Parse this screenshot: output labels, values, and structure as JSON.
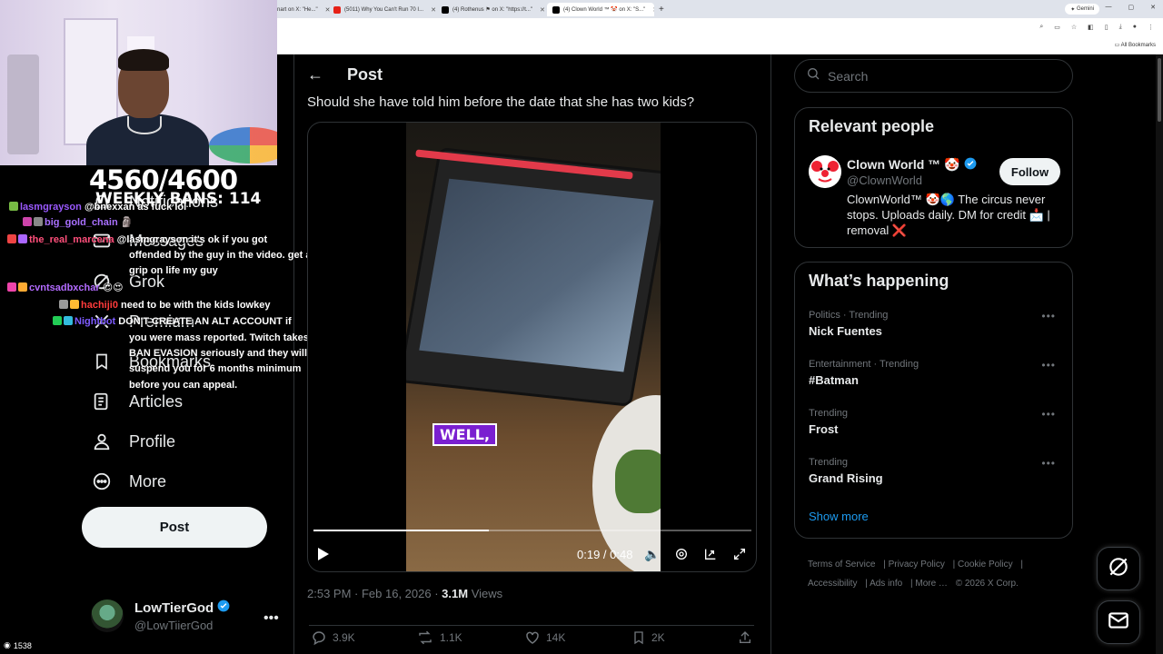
{
  "browser": {
    "tabs": [
      {
        "label": "nart on X: \"He...\"",
        "favicon": "x-icon"
      },
      {
        "label": "(5011) Why You Can't Run 70 I...",
        "favicon": "youtube-icon"
      },
      {
        "label": "(4) Rothenus ⚑ on X: \"https://t...\"",
        "favicon": "x-icon"
      },
      {
        "label": "(4) Clown World ™ 🤡 on X: \"S...\"",
        "favicon": "x-icon"
      }
    ],
    "gemini_label": "Gemini",
    "bookmarks_label": "All Bookmarks"
  },
  "stream": {
    "counter": "4560/4600",
    "weekly_bans": "WEEKLY BANS: 114",
    "chat": [
      {
        "user": "lasmgrayson",
        "text": "@bnexxan as fuck lol",
        "color": "#9b59ff"
      },
      {
        "user": "big_gold_chain",
        "text": "",
        "color": "#a970ff"
      },
      {
        "user": "the_real_marcena",
        "text": "@lasmgrayson it's ok if you got",
        "color": "#ff4f7b"
      },
      {
        "user": "",
        "text": "offended by the guy in the video. get a",
        "color": "#ffffff"
      },
      {
        "user": "",
        "text": "grip on life my guy",
        "color": "#ffffff"
      },
      {
        "user": "cvntsadbxchar",
        "text": "",
        "color": "#b36bff"
      },
      {
        "user": "hachiji0",
        "text": "need to be with the kids lowkey",
        "color": "#ff3b3b"
      },
      {
        "user": "Nightbot",
        "text": "DON'T CREATE AN ALT ACCOUNT if",
        "color": "#7d5bff"
      },
      {
        "user": "",
        "text": "you were mass reported. Twitch takes",
        "color": "#ffffff"
      },
      {
        "user": "",
        "text": "BAN EVASION seriously and they will",
        "color": "#ffffff"
      },
      {
        "user": "",
        "text": "suspend you for 6 months minimum",
        "color": "#ffffff"
      },
      {
        "user": "",
        "text": "before you can appeal.",
        "color": "#ffffff"
      }
    ],
    "viewers": "1538"
  },
  "nav": {
    "items": [
      {
        "label": "Notifications",
        "icon": "bell-icon"
      },
      {
        "label": "Messages",
        "icon": "envelope-icon"
      },
      {
        "label": "Grok",
        "icon": "grok-icon"
      },
      {
        "label": "Premium",
        "icon": "x-logo-icon"
      },
      {
        "label": "Bookmarks",
        "icon": "bookmark-icon"
      },
      {
        "label": "Articles",
        "icon": "article-icon"
      },
      {
        "label": "Profile",
        "icon": "person-icon"
      },
      {
        "label": "More",
        "icon": "more-circle-icon"
      }
    ],
    "post_button": "Post",
    "account": {
      "name": "LowTierGod",
      "handle": "@LowTiierGod"
    }
  },
  "post": {
    "header": "Post",
    "text": "Should she have told him before the date that she has two kids?",
    "video": {
      "caption": "WELL,",
      "time": "0:19 / 0:48",
      "progress": 0.4
    },
    "time": "2:53 PM",
    "date": "Feb 16, 2026",
    "views_count": "3.1M",
    "views_label": "Views",
    "replies": "3.9K",
    "reposts": "1.1K",
    "likes": "14K",
    "bookmarks": "2K"
  },
  "sidebar": {
    "search_placeholder": "Search",
    "relevant_title": "Relevant people",
    "person": {
      "name": "Clown World ™ 🤡",
      "handle": "@ClownWorld",
      "bio": "ClownWorld™ 🤡🌎 The circus never stops. Uploads daily. DM for credit 📩 | removal ❌",
      "follow_label": "Follow"
    },
    "happening_title": "What’s happening",
    "trends": [
      {
        "context": "Politics · Trending",
        "name": "Nick Fuentes"
      },
      {
        "context": "Entertainment · Trending",
        "name": "#Batman"
      },
      {
        "context": "Trending",
        "name": "Frost"
      },
      {
        "context": "Trending",
        "name": "Grand Rising"
      }
    ],
    "show_more": "Show more",
    "footer": {
      "terms": "Terms of Service",
      "privacy": "Privacy Policy",
      "cookie": "Cookie Policy",
      "accessibility": "Accessibility",
      "ads": "Ads info",
      "more": "More …",
      "copyright": "© 2026 X Corp."
    }
  },
  "colors": {
    "accent": "#1d9bf0",
    "background": "#000000",
    "border": "#2f3336"
  }
}
